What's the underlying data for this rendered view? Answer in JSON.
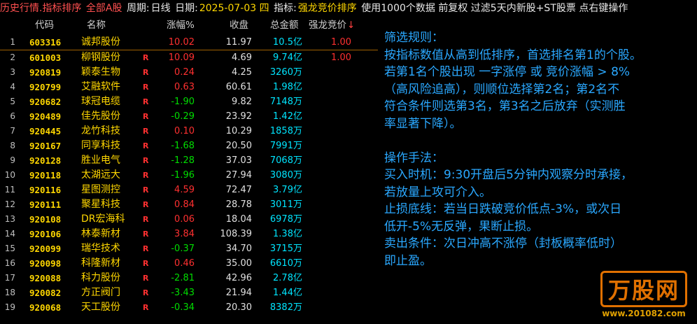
{
  "title": {
    "breadcrumb": "历史行情.指标排序",
    "market": "全部A股",
    "period_label": "周期:",
    "period": "日线",
    "date_label": "日期:",
    "date": "2025-07-03 四",
    "indicator_label": "指标:",
    "indicator": "强龙竞价排序",
    "options": "使用1000个数据 前复权 过滤5天内新股+ST股票 点右键操作"
  },
  "columns": {
    "code": "代码",
    "name": "名称",
    "change": "涨幅%",
    "close": "收盘",
    "amount": "总金额",
    "rank": "强龙竞价",
    "sort_arrow": "↓"
  },
  "rows": [
    {
      "idx": "1",
      "code": "603316",
      "name": "诚邦股份",
      "flag": "",
      "change": "10.02",
      "dir": "up",
      "close": "11.97",
      "amount": "10.5",
      "unit": "亿",
      "rank": "1.00"
    },
    {
      "idx": "2",
      "code": "601003",
      "name": "柳钢股份",
      "flag": "R",
      "change": "10.09",
      "dir": "up",
      "close": "4.69",
      "amount": "9.74",
      "unit": "亿",
      "rank": "1.00"
    },
    {
      "idx": "3",
      "code": "920819",
      "name": "颖泰生物",
      "flag": "R",
      "change": "0.24",
      "dir": "up",
      "close": "4.25",
      "amount": "3260",
      "unit": "万",
      "rank": ""
    },
    {
      "idx": "4",
      "code": "920799",
      "name": "艾融软件",
      "flag": "R",
      "change": "0.63",
      "dir": "up",
      "close": "60.61",
      "amount": "1.98",
      "unit": "亿",
      "rank": ""
    },
    {
      "idx": "5",
      "code": "920682",
      "name": "球冠电缆",
      "flag": "R",
      "change": "-1.90",
      "dir": "down",
      "close": "9.82",
      "amount": "7148",
      "unit": "万",
      "rank": ""
    },
    {
      "idx": "6",
      "code": "920489",
      "name": "佳先股份",
      "flag": "R",
      "change": "-0.29",
      "dir": "down",
      "close": "23.92",
      "amount": "1.42",
      "unit": "亿",
      "rank": ""
    },
    {
      "idx": "7",
      "code": "920445",
      "name": "龙竹科技",
      "flag": "R",
      "change": "0.10",
      "dir": "up",
      "close": "10.29",
      "amount": "1858",
      "unit": "万",
      "rank": ""
    },
    {
      "idx": "8",
      "code": "920167",
      "name": "同享科技",
      "flag": "R",
      "change": "-1.68",
      "dir": "down",
      "close": "20.50",
      "amount": "7991",
      "unit": "万",
      "rank": ""
    },
    {
      "idx": "9",
      "code": "920128",
      "name": "胜业电气",
      "flag": "R",
      "change": "-1.28",
      "dir": "down",
      "close": "37.03",
      "amount": "7068",
      "unit": "万",
      "rank": ""
    },
    {
      "idx": "10",
      "code": "920118",
      "name": "太湖远大",
      "flag": "R",
      "change": "-1.96",
      "dir": "down",
      "close": "27.94",
      "amount": "3080",
      "unit": "万",
      "rank": ""
    },
    {
      "idx": "11",
      "code": "920116",
      "name": "星图测控",
      "flag": "R",
      "change": "4.59",
      "dir": "up",
      "close": "72.47",
      "amount": "3.79",
      "unit": "亿",
      "rank": ""
    },
    {
      "idx": "12",
      "code": "920111",
      "name": "聚星科技",
      "flag": "R",
      "change": "0.84",
      "dir": "up",
      "close": "28.78",
      "amount": "3011",
      "unit": "万",
      "rank": ""
    },
    {
      "idx": "13",
      "code": "920108",
      "name": "DR宏海科",
      "flag": "R",
      "change": "0.06",
      "dir": "up",
      "close": "18.04",
      "amount": "6978",
      "unit": "万",
      "rank": ""
    },
    {
      "idx": "14",
      "code": "920106",
      "name": "林泰新材",
      "flag": "R",
      "change": "3.84",
      "dir": "up",
      "close": "108.39",
      "amount": "1.38",
      "unit": "亿",
      "rank": ""
    },
    {
      "idx": "15",
      "code": "920099",
      "name": "瑞华技术",
      "flag": "R",
      "change": "-0.37",
      "dir": "down",
      "close": "34.70",
      "amount": "3715",
      "unit": "万",
      "rank": ""
    },
    {
      "idx": "16",
      "code": "920098",
      "name": "科隆新材",
      "flag": "R",
      "change": "0.46",
      "dir": "up",
      "close": "35.00",
      "amount": "6610",
      "unit": "万",
      "rank": ""
    },
    {
      "idx": "17",
      "code": "920088",
      "name": "科力股份",
      "flag": "R",
      "change": "-2.81",
      "dir": "down",
      "close": "42.96",
      "amount": "2.78",
      "unit": "亿",
      "rank": ""
    },
    {
      "idx": "18",
      "code": "920082",
      "name": "方正阀门",
      "flag": "R",
      "change": "-3.43",
      "dir": "down",
      "close": "21.94",
      "amount": "1.44",
      "unit": "亿",
      "rank": ""
    },
    {
      "idx": "19",
      "code": "920068",
      "name": "天工股份",
      "flag": "R",
      "change": "-0.34",
      "dir": "down",
      "close": "20.30",
      "amount": "8382",
      "unit": "万",
      "rank": ""
    }
  ],
  "panel": {
    "filter_title": "筛选规则：",
    "filter_lines": [
      "按指标数值从高到低排序，首选排名第1的个股。",
      "若第1名个股出现 一字涨停 或 竞价涨幅 > 8%",
      "（高风险追高），则顺位选择第2名；第2名不",
      "符合条件则选第3名，第3名之后放弃（实测胜",
      "率显著下降）。"
    ],
    "op_title": "操作手法：",
    "op_lines": [
      "买入时机：9:30开盘后5分钟内观察分时承接，",
      "若放量上攻可介入。",
      "止损底线：若当日跌破竞价低点-3%，或次日",
      "低开-5%无反弹，果断止损。",
      "卖出条件：次日冲高不涨停（封板概率低时）",
      "即止盈。"
    ]
  },
  "watermark": {
    "logo": "万股网",
    "url": "www.201082.com"
  },
  "colors": {
    "background": "#000000",
    "up": "#ff3030",
    "down": "#00dd00",
    "code_name": "#ffd700",
    "amount": "#00e5ff",
    "panel_text": "#2aa8ff"
  }
}
